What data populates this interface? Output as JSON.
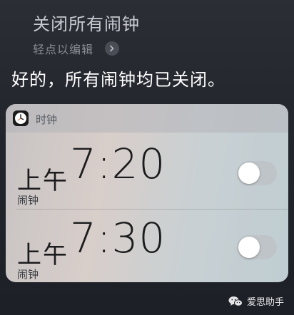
{
  "siri": {
    "query": "关闭所有闹钟",
    "edit_hint": "轻点以编辑",
    "response": "好的，所有闹钟均已关闭。"
  },
  "card": {
    "app_name": "时钟",
    "icon": "clock-icon",
    "alarms": [
      {
        "ampm": "上午",
        "time": "7:20",
        "label": "闹钟",
        "enabled": false
      },
      {
        "ampm": "上午",
        "time": "7:30",
        "label": "闹钟",
        "enabled": false
      }
    ]
  },
  "watermark": {
    "text": "爱思助手",
    "icon": "wechat-icon"
  }
}
